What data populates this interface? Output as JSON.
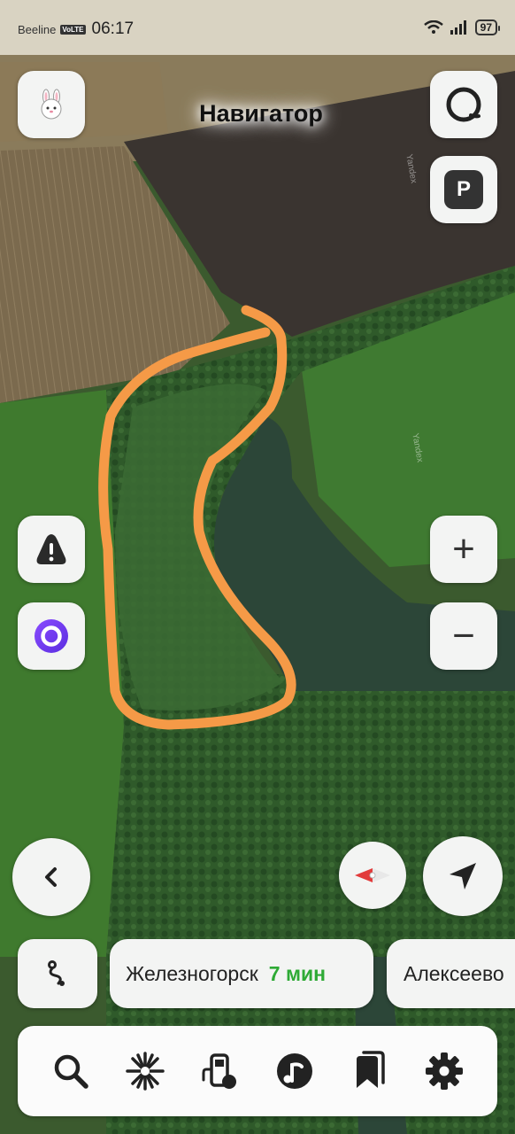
{
  "status_bar": {
    "carrier": "Beeline",
    "network_badge": "VoLTE",
    "time": "06:17",
    "battery": "97",
    "icons": [
      "wifi-icon",
      "signal-icon",
      "battery-icon"
    ]
  },
  "map": {
    "title": "Навигатор",
    "watermark": "Yandex",
    "annotation_color": "#f59a47"
  },
  "controls": {
    "profile_icon": "rabbit-icon",
    "alice_icon": "alice-icon",
    "parking_label": "P",
    "zoom_in_label": "+",
    "zoom_out_label": "−",
    "back_icon": "chevron-left-icon",
    "compass_icon": "compass-icon",
    "location_icon": "navigation-arrow-icon",
    "route_icon": "route-icon",
    "report_icon": "warning-icon",
    "alice_voice_icon": "alice-voice-icon"
  },
  "destinations": [
    {
      "name": "Железногорск",
      "eta": "7 мин"
    },
    {
      "name": "Алексеево",
      "eta": ""
    }
  ],
  "tabbar": {
    "tabs": [
      "search-icon",
      "discovery-icon",
      "gas-station-icon",
      "music-icon",
      "bookmarks-icon",
      "settings-icon"
    ]
  },
  "colors": {
    "button_bg": "#f3f4f3",
    "eta_green": "#2eaa35",
    "alice_purple": "#6c3cf0",
    "compass_red": "#e23b3b"
  }
}
